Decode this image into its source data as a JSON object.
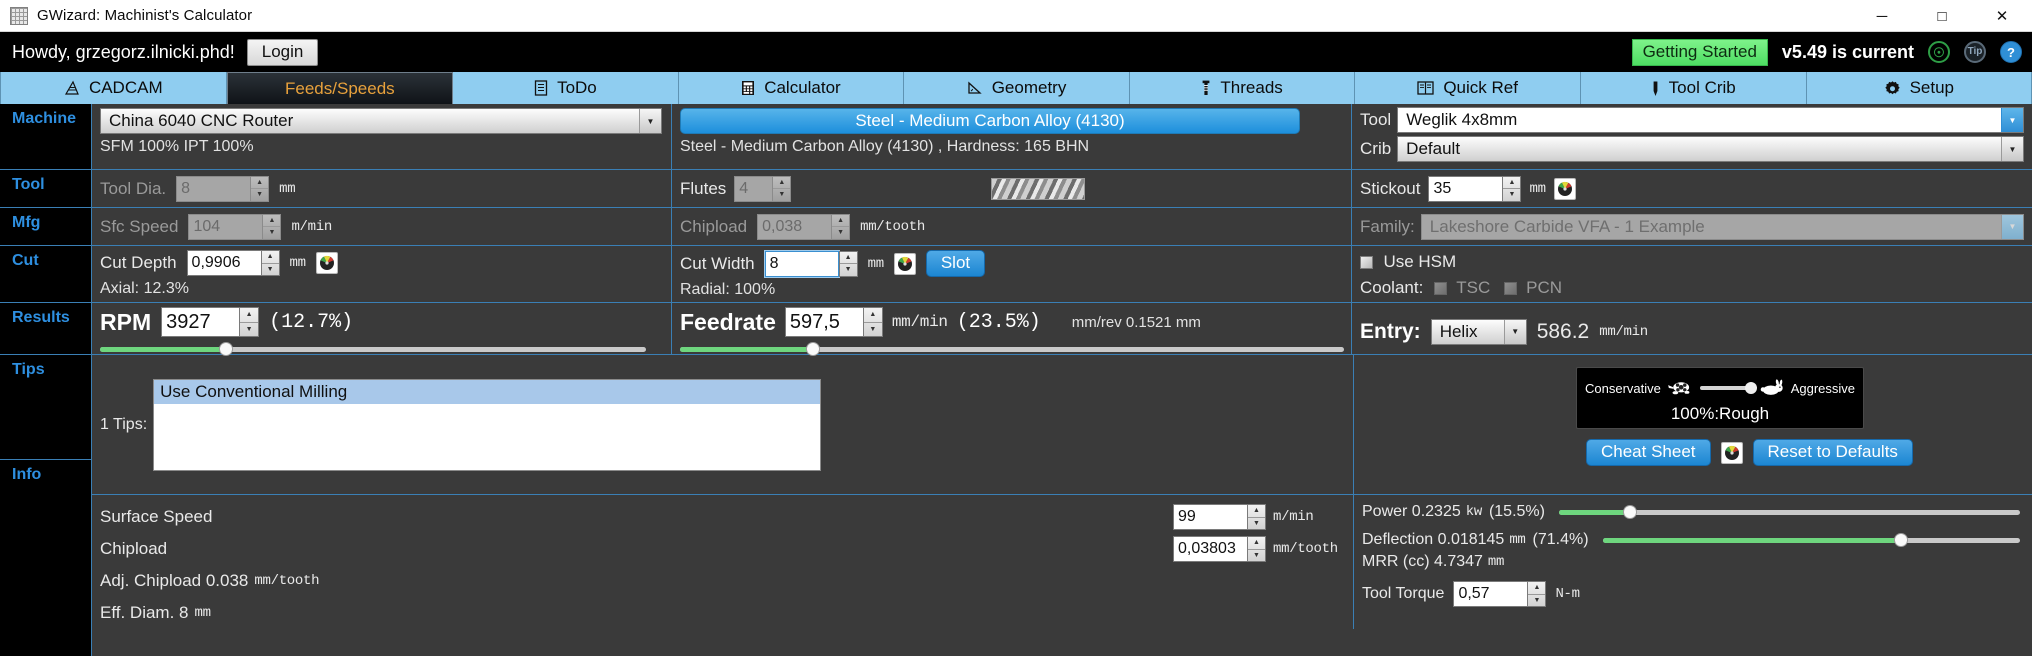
{
  "window": {
    "title": "GWizard: Machinist's Calculator",
    "minimize": "─",
    "maximize": "□",
    "close": "✕"
  },
  "header": {
    "greeting": "Howdy, grzegorz.ilnicki.phd!",
    "login_label": "Login",
    "getting_started": "Getting Started",
    "version_status": "v5.49 is current",
    "icons": [
      "headset-icon",
      "tip-icon",
      "help-icon"
    ],
    "tip_label": "Tip",
    "help_label": "?"
  },
  "tabs": [
    {
      "label": "CADCAM",
      "icon": "cadcam-icon",
      "active": false
    },
    {
      "label": "Feeds/Speeds",
      "icon": "feeds-speeds-icon",
      "active": true
    },
    {
      "label": "ToDo",
      "icon": "todo-list-icon",
      "active": false
    },
    {
      "label": "Calculator",
      "icon": "calculator-icon",
      "active": false
    },
    {
      "label": "Geometry",
      "icon": "geometry-icon",
      "active": false
    },
    {
      "label": "Threads",
      "icon": "threads-icon",
      "active": false
    },
    {
      "label": "Quick Ref",
      "icon": "book-icon",
      "active": false
    },
    {
      "label": "Tool Crib",
      "icon": "tool-crib-icon",
      "active": false
    },
    {
      "label": "Setup",
      "icon": "gear-icon",
      "active": false
    }
  ],
  "sidebar": {
    "sections": [
      "Machine",
      "Tool",
      "Mfg",
      "Cut",
      "Results",
      "Tips",
      "Info"
    ]
  },
  "machine": {
    "selected": "China 6040 CNC Router",
    "percentages": "SFM 100% IPT 100%"
  },
  "material": {
    "banner": "Steel - Medium Carbon Alloy (4130)",
    "detail": "Steel - Medium Carbon Alloy (4130) , Hardness: 165 BHN"
  },
  "tool_panel": {
    "tool_label": "Tool",
    "tool_value": "Weglik 4x8mm",
    "crib_label": "Crib",
    "crib_value": "Default",
    "stickout_label": "Stickout",
    "stickout_value": "35",
    "stickout_unit": "mm",
    "family_label": "Family:",
    "family_value": "Lakeshore Carbide VFA - 1 Example",
    "use_hsm_label": "Use HSM",
    "coolant_label": "Coolant:",
    "coolant_tsc": "TSC",
    "coolant_pcn": "PCN"
  },
  "tool_row": {
    "label": "Tool Dia.",
    "value": "8",
    "unit": "mm",
    "flutes_label": "Flutes",
    "flutes_value": "4"
  },
  "mfg_row": {
    "label": "Sfc Speed",
    "value": "104",
    "unit": "m/min",
    "chipload_label": "Chipload",
    "chipload_value": "0,038",
    "chipload_unit": "mm/tooth"
  },
  "cut_row": {
    "depth_label": "Cut Depth",
    "depth_value": "0,9906",
    "depth_unit": "mm",
    "axial": "Axial: 12.3%",
    "width_label": "Cut Width",
    "width_value": "8",
    "width_unit": "mm",
    "slot_label": "Slot",
    "radial": "Radial: 100%"
  },
  "results": {
    "rpm_label": "RPM",
    "rpm_value": "3927",
    "rpm_pct": "(12.7%)",
    "rpm_slider_pct": 12.7,
    "feedrate_label": "Feedrate",
    "feedrate_value": "597,5",
    "feedrate_unit": "mm/min",
    "feedrate_pct": "(23.5%)",
    "feedrate_slider_pct": 23.5,
    "mm_per_rev": "mm/rev 0.1521 mm",
    "entry_label": "Entry:",
    "entry_value": "Helix",
    "entry_rate": "586.2",
    "entry_unit": "mm/min"
  },
  "tips": {
    "count_label": "1 Tips:",
    "items": [
      "Use Conventional Milling"
    ]
  },
  "aggression": {
    "conservative_label": "Conservative",
    "aggressive_label": "Aggressive",
    "value_label": "100%:Rough",
    "slider_pct": 100,
    "cheat_sheet_label": "Cheat Sheet",
    "reset_label": "Reset to Defaults"
  },
  "info": {
    "surface_speed_label": "Surface Speed",
    "surface_speed_value": "99",
    "surface_speed_unit": "m/min",
    "chipload_label": "Chipload",
    "chipload_value": "0,03803",
    "chipload_unit": "mm/tooth",
    "adj_chipload_label": "Adj. Chipload 0.038",
    "adj_chipload_unit": "mm/tooth",
    "eff_diam_label": "Eff. Diam. 8",
    "eff_diam_unit": "mm"
  },
  "metrics": {
    "power_label": "Power 0.2325",
    "power_unit": "kw",
    "power_pct": "(15.5%)",
    "power_slider_pct": 15.5,
    "deflection_label": "Deflection 0.018145",
    "deflection_unit": "mm",
    "deflection_pct": "(71.4%)",
    "deflection_slider_pct": 71.4,
    "mrr_label": "MRR (cc) 4.7347",
    "mrr_unit": "mm",
    "torque_label": "Tool Torque",
    "torque_value": "0,57",
    "torque_unit": "N-m"
  },
  "colors": {
    "accent_blue": "#2e8fe0",
    "tab_blue": "#8fcdf0",
    "green": "#6ed67e",
    "border": "#3a7fb5",
    "panel_bg": "#3a3a3a",
    "orange_text": "#e8a13c"
  }
}
